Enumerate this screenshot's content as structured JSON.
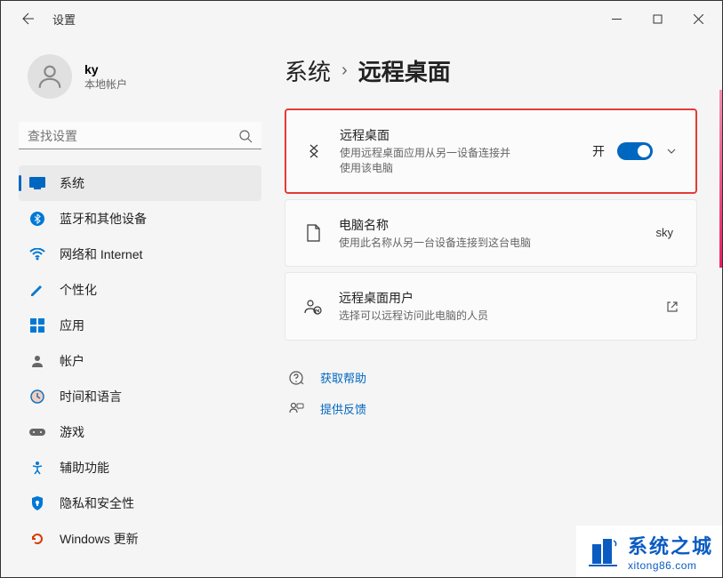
{
  "window": {
    "title": "设置"
  },
  "user": {
    "name": "ky",
    "account_type": "本地帐户"
  },
  "search": {
    "placeholder": "查找设置"
  },
  "nav": {
    "items": [
      {
        "label": "系统",
        "icon": "system",
        "active": true
      },
      {
        "label": "蓝牙和其他设备",
        "icon": "bluetooth"
      },
      {
        "label": "网络和 Internet",
        "icon": "wifi"
      },
      {
        "label": "个性化",
        "icon": "personalize"
      },
      {
        "label": "应用",
        "icon": "apps"
      },
      {
        "label": "帐户",
        "icon": "accounts"
      },
      {
        "label": "时间和语言",
        "icon": "time"
      },
      {
        "label": "游戏",
        "icon": "gaming"
      },
      {
        "label": "辅助功能",
        "icon": "accessibility"
      },
      {
        "label": "隐私和安全性",
        "icon": "privacy"
      },
      {
        "label": "Windows 更新",
        "icon": "update"
      }
    ]
  },
  "breadcrumb": {
    "parent": "系统",
    "current": "远程桌面"
  },
  "cards": {
    "remote_desktop": {
      "title": "远程桌面",
      "desc": "使用远程桌面应用从另一设备连接并使用该电脑",
      "toggle_label": "开",
      "toggle_state": "on"
    },
    "pc_name": {
      "title": "电脑名称",
      "desc": "使用此名称从另一台设备连接到这台电脑",
      "value": "sky"
    },
    "remote_users": {
      "title": "远程桌面用户",
      "desc": "选择可以远程访问此电脑的人员"
    }
  },
  "links": {
    "help": "获取帮助",
    "feedback": "提供反馈"
  },
  "watermark": {
    "main": "系统之城",
    "sub": "xitong86.com"
  },
  "colors": {
    "accent": "#0067c0",
    "highlight": "#e43b36"
  }
}
